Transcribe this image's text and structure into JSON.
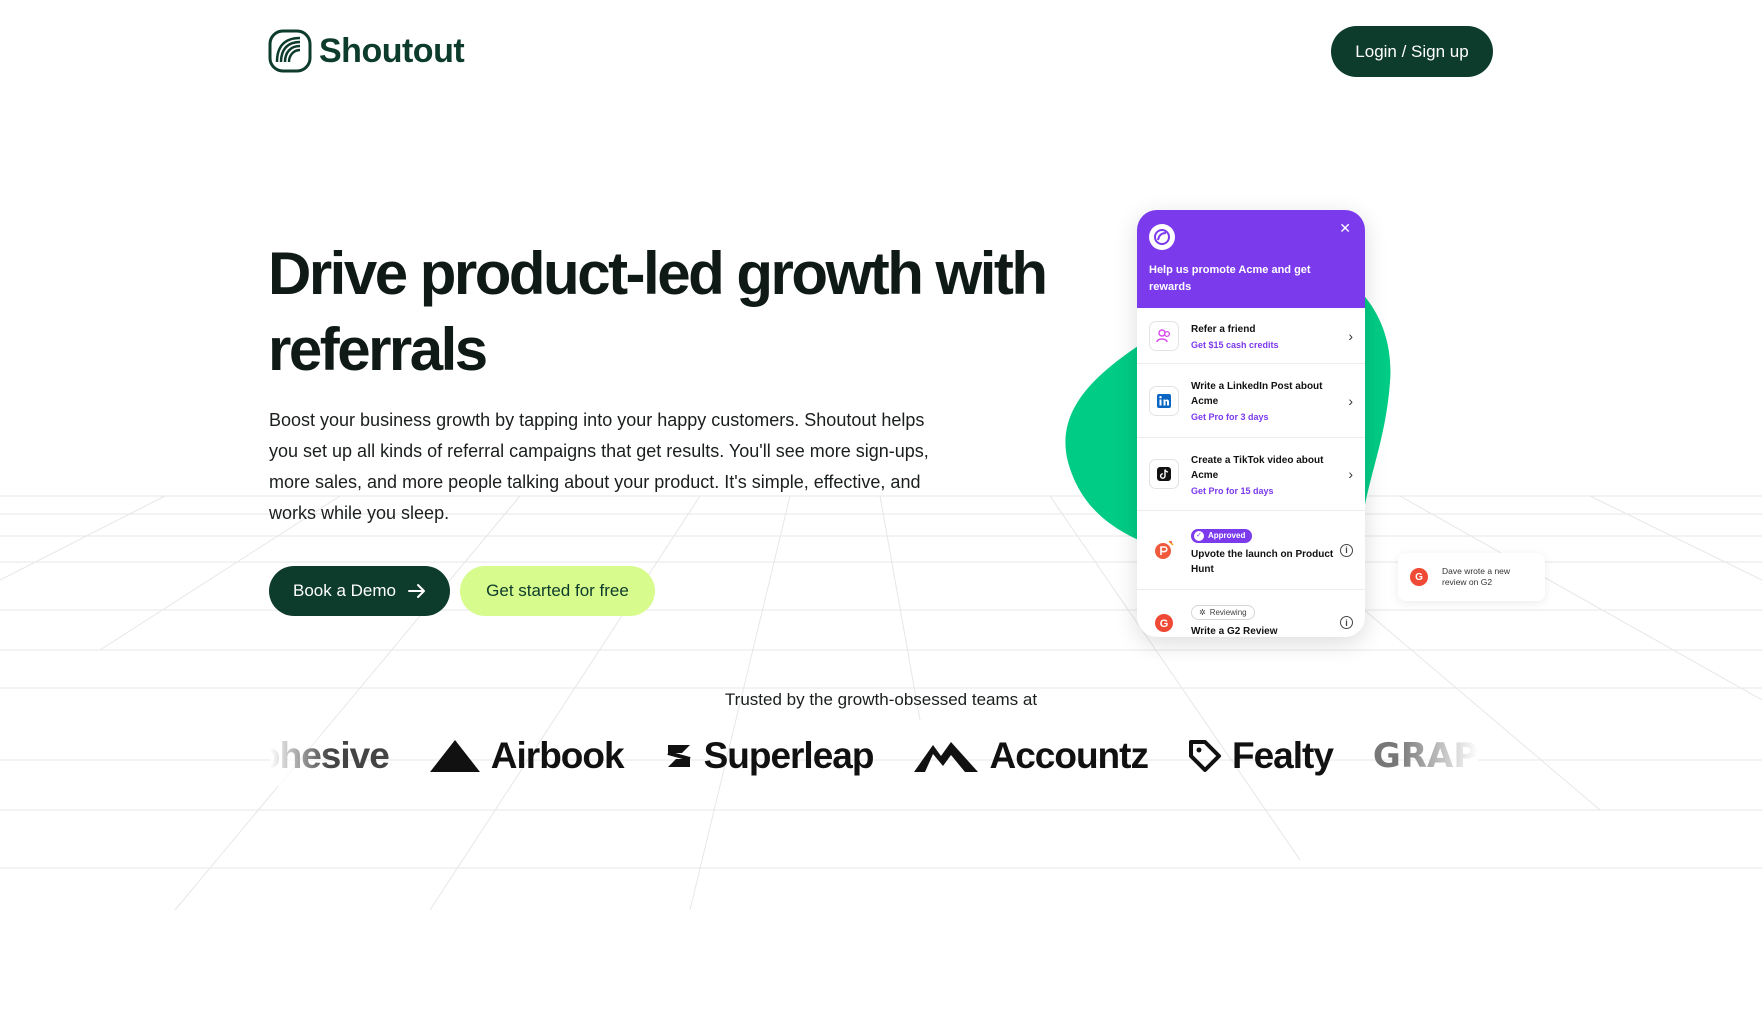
{
  "header": {
    "brand": "Shoutout",
    "login_label": "Login / Sign up"
  },
  "hero": {
    "title": "Drive product-led growth with referrals",
    "subtitle": "Boost your business growth by tapping into your happy customers. Shoutout helps you set up all kinds of referral campaigns that get results. You'll see more sign-ups, more sales, and more people talking about your product. It's simple, effective, and works while you sleep.",
    "demo_label": "Book a Demo",
    "free_label": "Get started for free"
  },
  "widget": {
    "heading": "Help us promote Acme and get rewards",
    "tasks": [
      {
        "title": "Refer a friend",
        "reward": "Get $15 cash credits",
        "icon": "people-icon"
      },
      {
        "title": "Write a LinkedIn Post about Acme",
        "reward": "Get Pro for 3 days",
        "icon": "linkedin-icon"
      },
      {
        "title": "Create a TikTok video about Acme",
        "reward": "Get Pro for 15 days",
        "icon": "tiktok-icon"
      },
      {
        "status": "Approved",
        "title": "Upvote the launch on Product Hunt",
        "icon": "product-hunt-icon"
      },
      {
        "status": "Reviewing",
        "title": "Write a G2 Review",
        "icon": "g2-icon"
      }
    ]
  },
  "toast": {
    "text": "Dave wrote a new review on G2"
  },
  "trusted": {
    "heading": "Trusted by the growth-obsessed teams at",
    "logos": [
      "ohesive",
      "Airbook",
      "Superleap",
      "Accountz",
      "Fealty",
      "GRAPHY"
    ]
  },
  "colors": {
    "brand_dark": "#0d3b2c",
    "accent_lime": "#d7fb8c",
    "widget_purple": "#7c3aed",
    "blob_green": "#00cc85"
  }
}
